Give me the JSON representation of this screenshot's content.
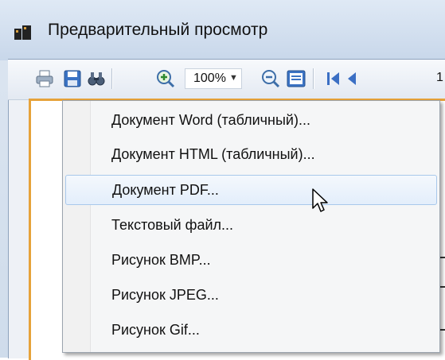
{
  "window": {
    "title": "Предварительный просмотр"
  },
  "toolbar": {
    "zoom_value": "100%",
    "page_number": "1",
    "buttons": [
      "print-icon",
      "save-icon",
      "find-icon",
      "zoom-in-icon",
      "zoom-out-icon",
      "fit-page-icon",
      "first-page-icon",
      "prev-page-icon"
    ]
  },
  "export_menu": {
    "items": [
      "Документ Word (табличный)...",
      "Документ HTML (табличный)...",
      "Документ PDF...",
      "Текстовый файл...",
      "Рисунок BMP...",
      "Рисунок JPEG...",
      "Рисунок Gif..."
    ],
    "hovered_item": "Документ PDF..."
  },
  "colors": {
    "accent": "#3b6fc4",
    "page_border": "#e6a23a",
    "hover_border": "#a8c8eb"
  }
}
